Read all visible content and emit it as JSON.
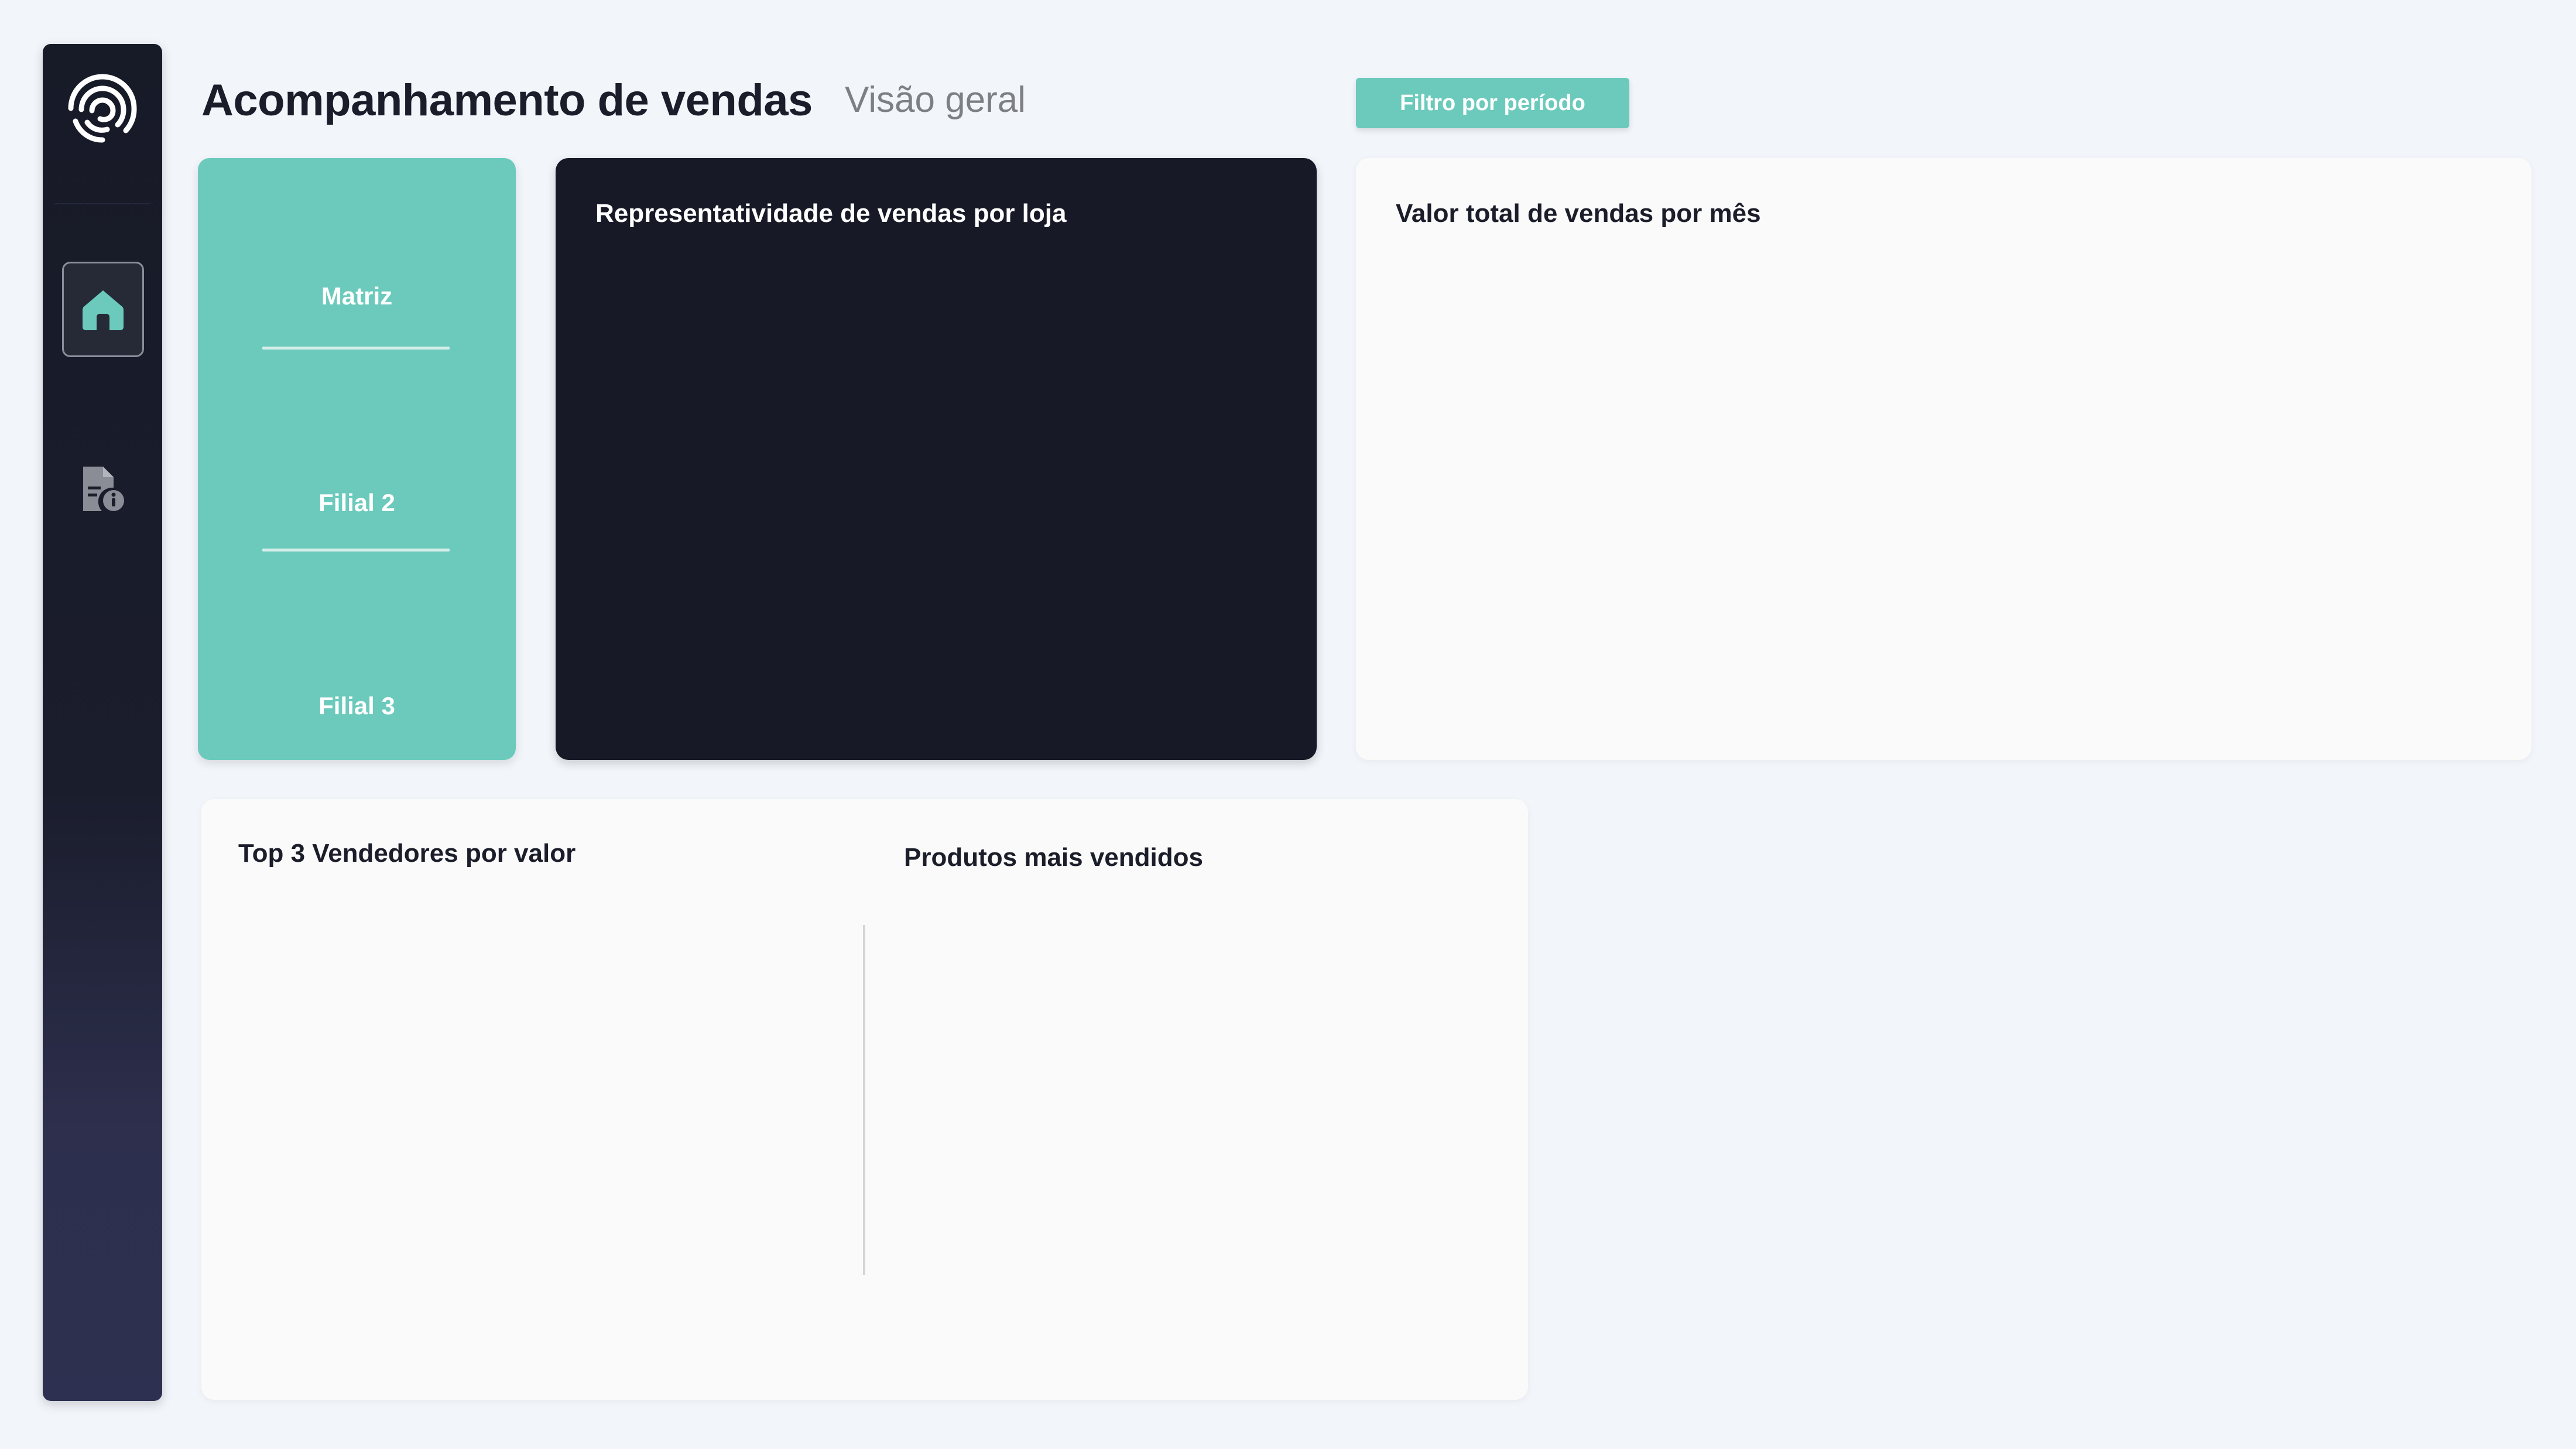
{
  "sidebar": {
    "logo_icon": "fingerprint-logo-icon",
    "nav": [
      {
        "icon": "home-icon",
        "active": true
      },
      {
        "icon": "report-info-icon",
        "active": false
      }
    ]
  },
  "header": {
    "title": "Acompanhamento de vendas",
    "subtitle": "Visão geral",
    "filter_button_label": "Filtro por período"
  },
  "stores": {
    "items": [
      {
        "label": "Matriz"
      },
      {
        "label": "Filial 2"
      },
      {
        "label": "Filial 3"
      }
    ]
  },
  "cards": {
    "share_by_store_title": "Representatividade de vendas por loja",
    "monthly_total_title": "Valor total de vendas por mês",
    "top_sellers_title": "Top 3 Vendedores por valor",
    "top_products_title": "Produtos mais vendidos"
  },
  "colors": {
    "accent": "#6bcabc",
    "sidebar_dark": "#171a27",
    "dark_card": "#171a26",
    "background": "#f2f6fb",
    "text_dark": "#1b1e2a"
  }
}
